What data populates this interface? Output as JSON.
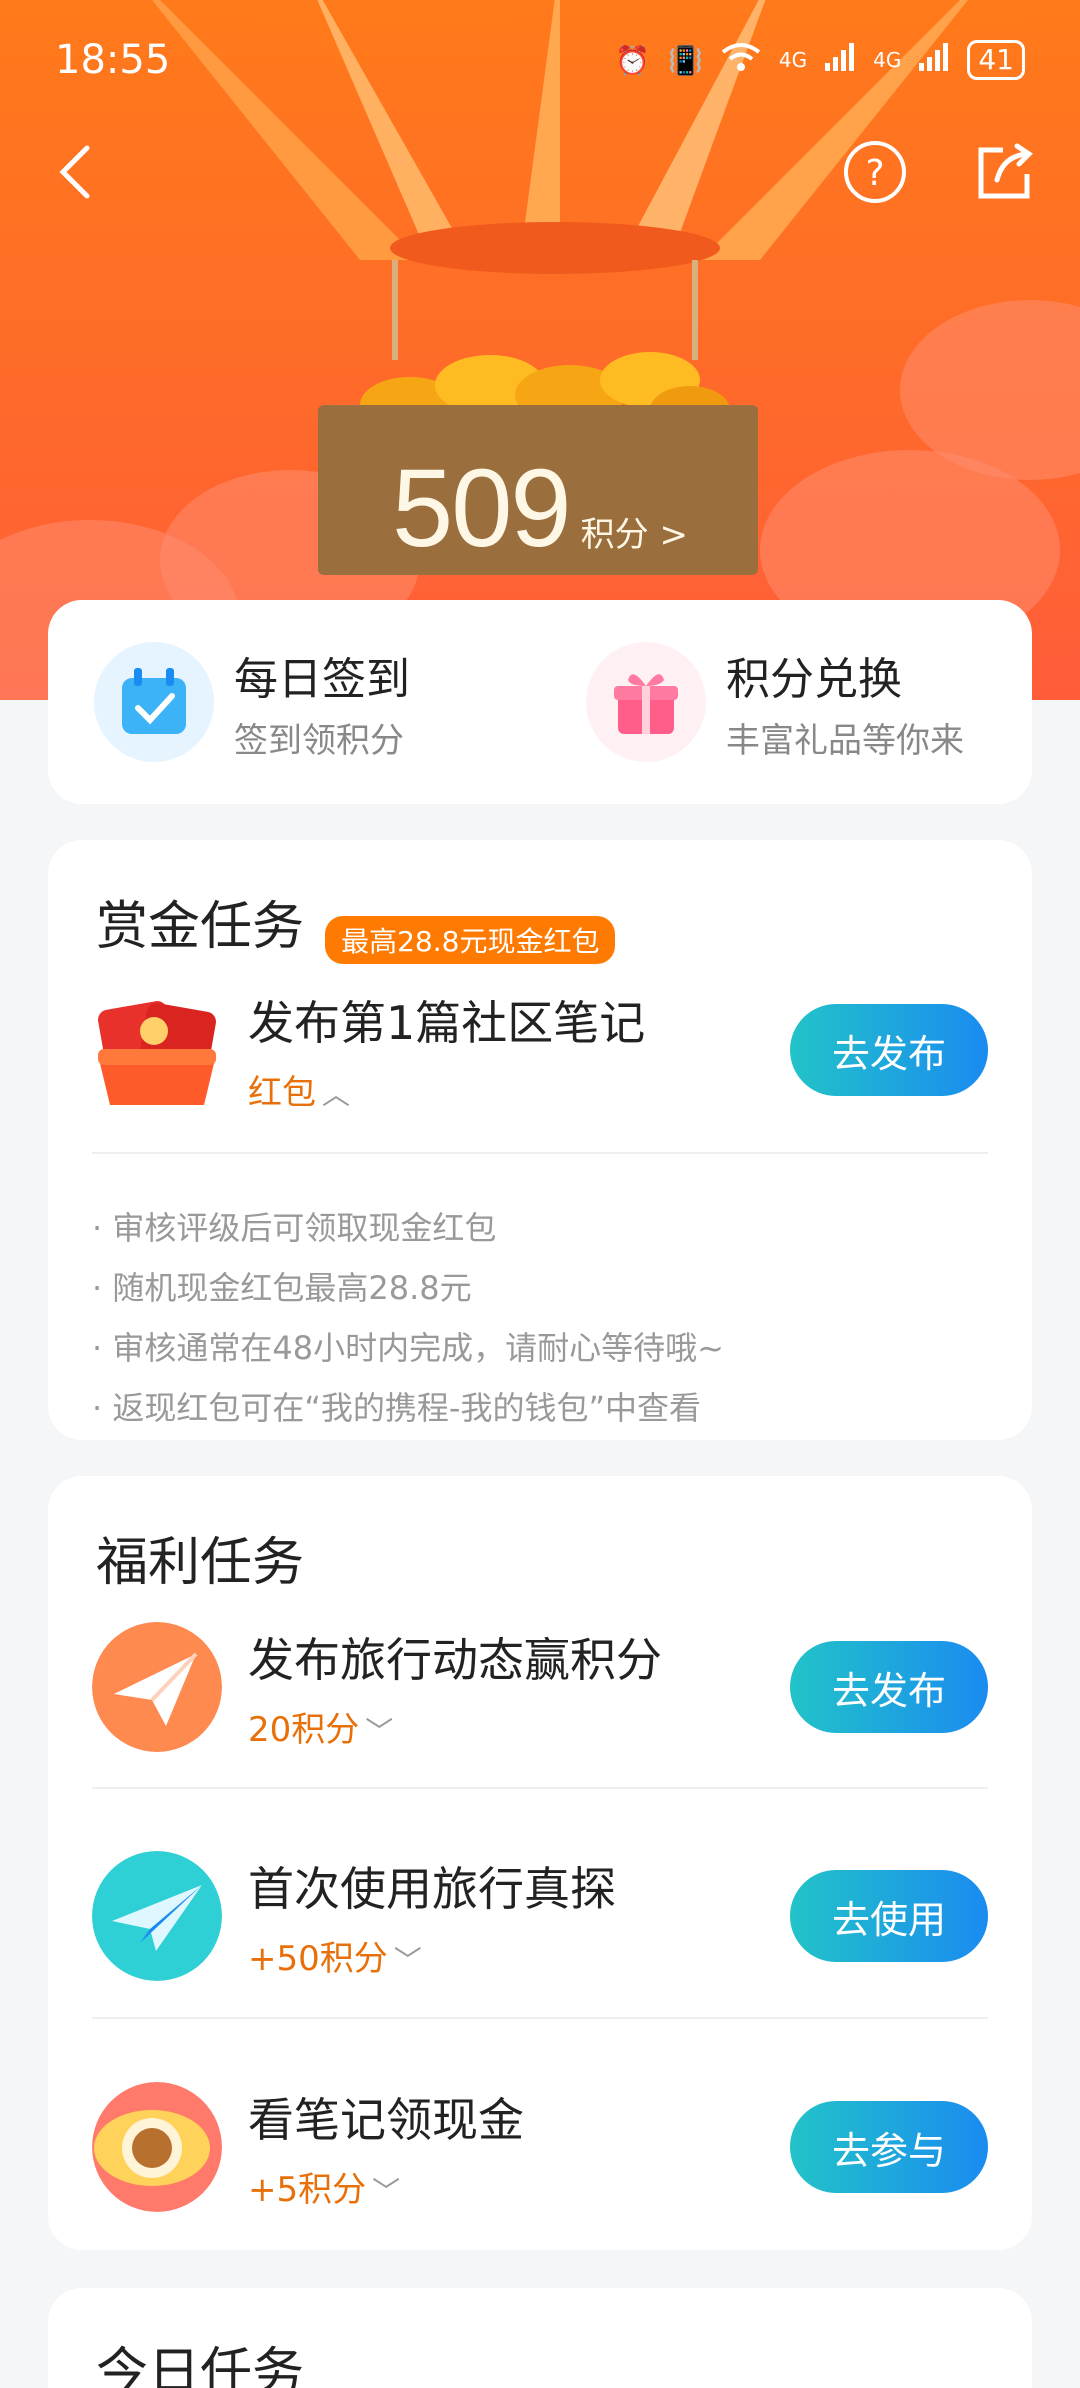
{
  "status_bar": {
    "time": "18:55",
    "signal_1": "4G",
    "signal_2": "4G",
    "battery": "41"
  },
  "header": {
    "points_value": "509",
    "points_unit": "积分 >"
  },
  "quick_actions": [
    {
      "title": "每日签到",
      "subtitle": "签到领积分"
    },
    {
      "title": "积分兑换",
      "subtitle": "丰富礼品等你来"
    }
  ],
  "bounty": {
    "title": "赏金任务",
    "tag": "最高28.8元现金红包",
    "task_name": "发布第1篇社区笔记",
    "task_reward": "红包",
    "button": "去发布",
    "notes": [
      "· 审核评级后可领取现金红包",
      "· 随机现金红包最高28.8元",
      "· 审核通常在48小时内完成，请耐心等待哦~",
      "· 返现红包可在“我的携程-我的钱包”中查看"
    ]
  },
  "welfare": {
    "title": "福利任务",
    "tasks": [
      {
        "name": "发布旅行动态赢积分",
        "points": "20积分",
        "button": "去发布"
      },
      {
        "name": "首次使用旅行真探",
        "points": "+50积分",
        "button": "去使用"
      },
      {
        "name": "看笔记领现金",
        "points": "+5积分",
        "button": "去参与"
      }
    ]
  },
  "today": {
    "title": "今日任务"
  },
  "colors": {
    "accent_orange": "#ff7a00",
    "button_gradient_start": "#22c3c8",
    "button_gradient_end": "#1a8bf0"
  }
}
